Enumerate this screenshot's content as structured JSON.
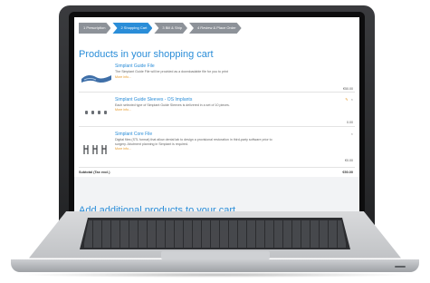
{
  "steps": [
    {
      "label": "1 Prescription",
      "active": false
    },
    {
      "label": "2 Shopping Cart",
      "active": true
    },
    {
      "label": "3 Bill & Ship",
      "active": false
    },
    {
      "label": "4 Review & Place Order",
      "active": false
    }
  ],
  "cart": {
    "heading": "Products in your shopping cart",
    "items": [
      {
        "title": "Simplant Guide File",
        "description": "The Simplant Guide File will be provided as a downloadable file for you to print",
        "more": "More info...",
        "price": "€50.00",
        "thumb_icon": "guide-file-icon"
      },
      {
        "title": "Simplant Guide Sleeves - OS Implants",
        "description": "Each selected type of Simplant Guide Sleeves is delivered in a set of 10 pieces.",
        "more": "More info...",
        "price": "0.00",
        "controls": {
          "edit": "✎",
          "remove": "×"
        },
        "thumb_icon": "sleeves-icon"
      },
      {
        "title": "Simplant Core File",
        "description_lines": [
          "Digital files (STL format) that allow dental lab to design a provisional restoration in third-party software prior to",
          "surgery. Abutment planning in Simplant is required."
        ],
        "more": "More info...",
        "price": "€0.00",
        "controls": {
          "remove": "×"
        },
        "thumb_icon": "core-file-icon"
      }
    ],
    "subtotal_label": "Subtotal (Tax excl.)",
    "subtotal_value": "€50.00"
  },
  "additional": {
    "heading": "Add additional products to your cart"
  },
  "colors": {
    "accent": "#2a8dd8",
    "step_inactive": "#8d9299",
    "link_more": "#e59a2b"
  }
}
